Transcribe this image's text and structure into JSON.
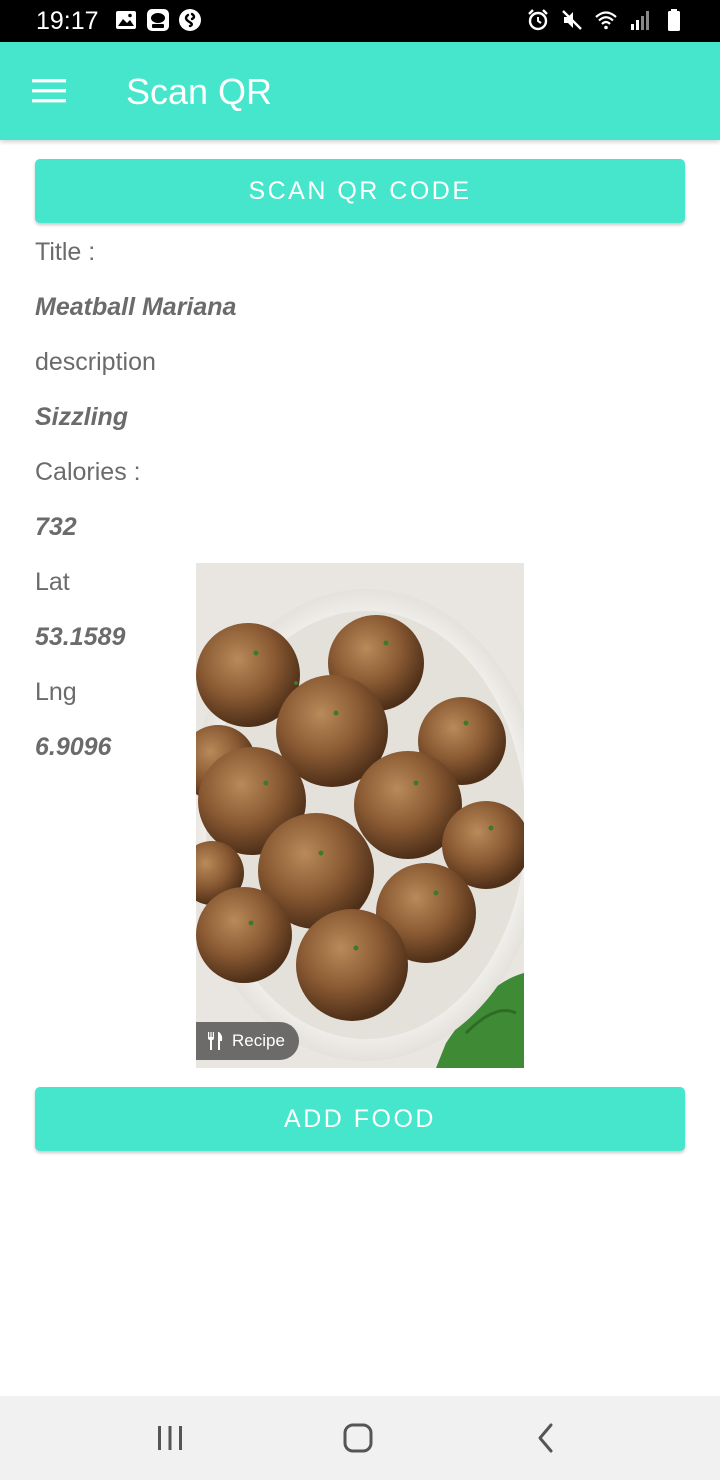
{
  "status_bar": {
    "time": "19:17",
    "left_icons": [
      "image-icon",
      "lineplus-icon",
      "shazam-icon"
    ],
    "right_icons": [
      "alarm-icon",
      "mute-icon",
      "wifi-icon",
      "signal-icon",
      "battery-icon"
    ]
  },
  "app_bar": {
    "title": "Scan QR",
    "menu_icon": "hamburger-menu-icon",
    "color": "#45e6cc"
  },
  "scan_button": {
    "label": "SCAN QR CODE"
  },
  "details": {
    "title_label": "Title :",
    "title_value": "Meatball Mariana",
    "description_label": "description",
    "description_value": "Sizzling",
    "calories_label": "Calories :",
    "calories_value": "732",
    "lat_label": "Lat",
    "lat_value": "53.1589",
    "lng_label": "Lng",
    "lng_value": "6.9096"
  },
  "food_image": {
    "subject": "bowl of meatballs",
    "badge_icon": "fork-knife-icon",
    "badge_label": "Recipe"
  },
  "add_button": {
    "label": "ADD FOOD"
  },
  "nav_bar": {
    "buttons": [
      "recent-apps-icon",
      "home-icon",
      "back-icon"
    ]
  }
}
